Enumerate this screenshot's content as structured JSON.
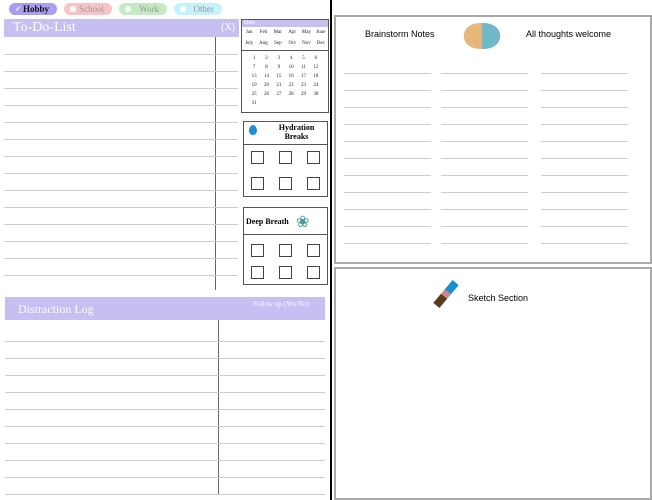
{
  "tags": [
    {
      "label": "Hobby",
      "color": "#a99ef0",
      "text": "#111",
      "checked": true
    },
    {
      "label": "School",
      "color": "#f7c4c8",
      "text": "#999"
    },
    {
      "label": "Work",
      "color": "#c4e9c4",
      "text": "#999"
    },
    {
      "label": "Other",
      "color": "#c5f3fb",
      "text": "#999"
    }
  ],
  "todo": {
    "title": "To-Do-List",
    "mark": "(X)"
  },
  "calendar": {
    "title": "Date",
    "months": [
      "Jan",
      "Feb",
      "Mar",
      "Apr",
      "May",
      "June",
      "July",
      "Aug",
      "Sep",
      "Oct",
      "Nov",
      "Dec"
    ],
    "days": [
      "1",
      "2",
      "3",
      "4",
      "5",
      "6",
      "7",
      "8",
      "9",
      "10",
      "11",
      "12",
      "13",
      "14",
      "15",
      "16",
      "17",
      "18",
      "19",
      "20",
      "21",
      "22",
      "23",
      "24",
      "25",
      "26",
      "27",
      "28",
      "29",
      "30",
      "31"
    ]
  },
  "hydration": {
    "title": "Hydration Breaks"
  },
  "breath": {
    "title": "Deep Breath"
  },
  "distraction": {
    "title": "Distraction Log",
    "followup": "Follow up (Yes/No)"
  },
  "brainstorm": {
    "title": "Brainstorm Notes",
    "subtitle": "All thoughts welcome"
  },
  "sketch": {
    "title": "Sketch Section"
  }
}
